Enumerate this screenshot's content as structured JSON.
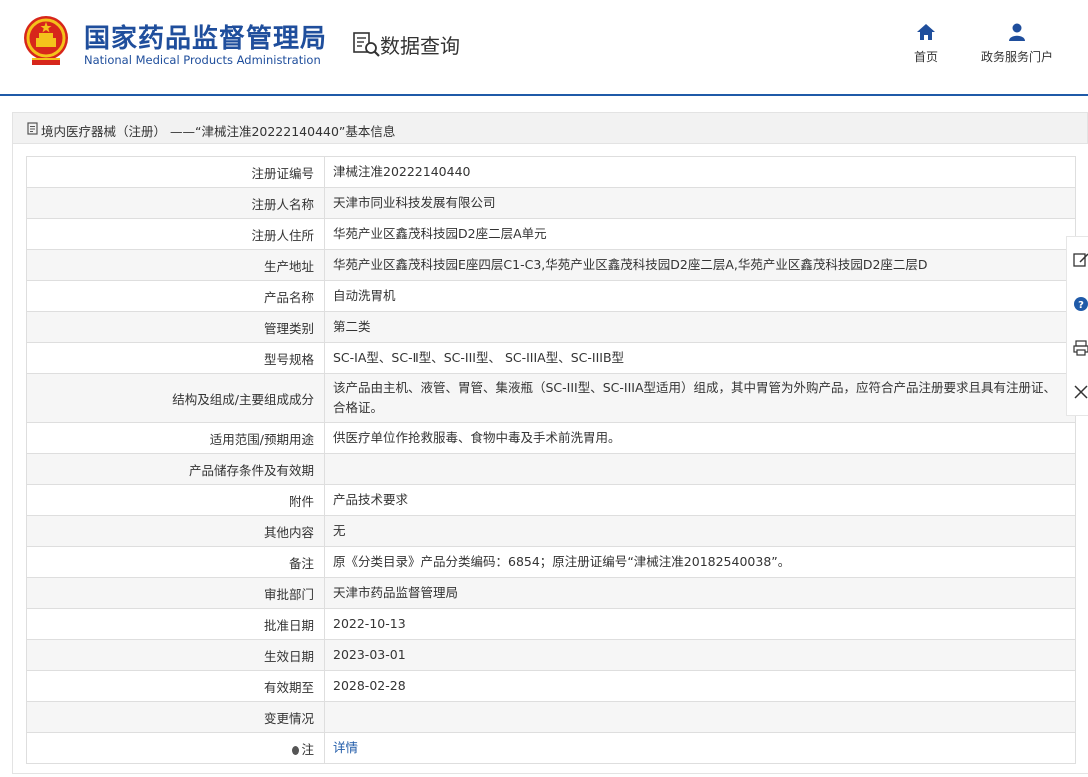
{
  "header": {
    "org_name_cn": "国家药品监督管理局",
    "org_name_en": "National Medical Products Administration",
    "section_title": "数据查询",
    "nav": {
      "home": "首页",
      "portal": "政务服务门户"
    }
  },
  "breadcrumb": {
    "text": "境内医疗器械（注册）  ——“津械注准20222140440”基本信息"
  },
  "rows": [
    {
      "label": "注册证编号",
      "value": "津械注准20222140440"
    },
    {
      "label": "注册人名称",
      "value": "天津市同业科技发展有限公司"
    },
    {
      "label": "注册人住所",
      "value": "华苑产业区鑫茂科技园D2座二层A单元"
    },
    {
      "label": "生产地址",
      "value": "华苑产业区鑫茂科技园E座四层C1-C3,华苑产业区鑫茂科技园D2座二层A,华苑产业区鑫茂科技园D2座二层D"
    },
    {
      "label": "产品名称",
      "value": "自动洗胃机"
    },
    {
      "label": "管理类别",
      "value": "第二类"
    },
    {
      "label": "型号规格",
      "value": "SC-ⅠA型、SC-Ⅱ型、SC-III型、 SC-IIIA型、SC-IIIB型"
    },
    {
      "label": "结构及组成/主要组成成分",
      "value": "该产品由主机、液管、胃管、集液瓶（SC-III型、SC-IIIA型适用）组成，其中胃管为外购产品，应符合产品注册要求且具有注册证、合格证。"
    },
    {
      "label": "适用范围/预期用途",
      "value": "供医疗单位作抢救服毒、食物中毒及手术前洗胃用。"
    },
    {
      "label": "产品储存条件及有效期",
      "value": ""
    },
    {
      "label": "附件",
      "value": "产品技术要求"
    },
    {
      "label": "其他内容",
      "value": "无"
    },
    {
      "label": "备注",
      "value": "原《分类目录》产品分类编码：6854；原注册证编号“津械注准20182540038”。"
    },
    {
      "label": "审批部门",
      "value": "天津市药品监督管理局"
    },
    {
      "label": "批准日期",
      "value": "2022-10-13"
    },
    {
      "label": "生效日期",
      "value": "2023-03-01"
    },
    {
      "label": "有效期至",
      "value": "2028-02-28"
    },
    {
      "label": "变更情况",
      "value": ""
    },
    {
      "label": "注",
      "value": "详情"
    }
  ],
  "side_tools": [
    "edit-icon",
    "help-icon",
    "print-icon",
    "close-icon"
  ],
  "colors": {
    "brand": "#1f4e9c",
    "link": "#1f5aa8",
    "emblem_red": "#d7261b",
    "emblem_gold": "#f4c21b"
  }
}
